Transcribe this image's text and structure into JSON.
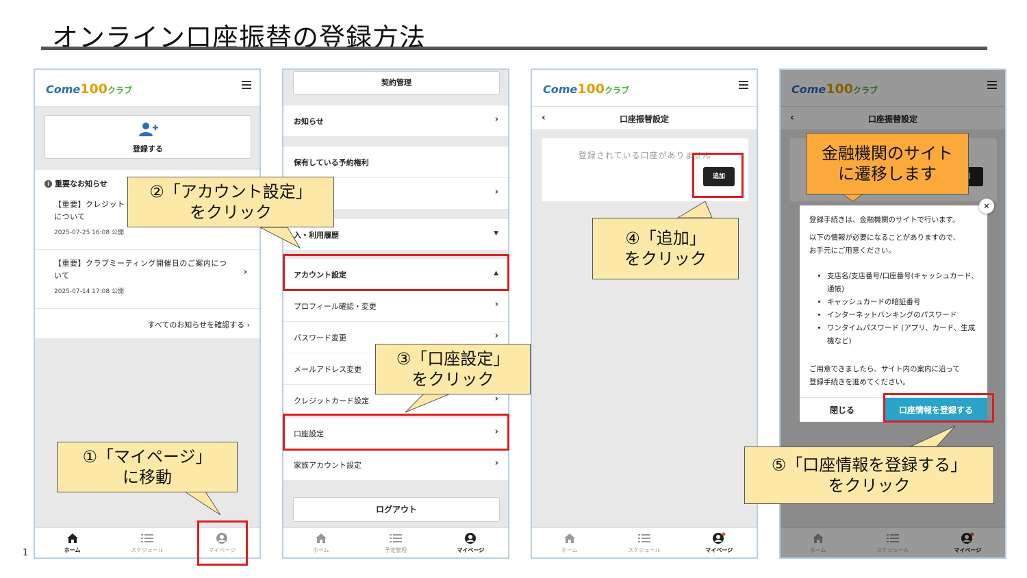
{
  "slide": {
    "title": "オンライン口座振替の登録方法",
    "page_number": "1"
  },
  "logo": {
    "part1": "Come",
    "part2": "100",
    "part3": "クラブ"
  },
  "bottom_nav": {
    "home": "ホーム",
    "schedule": "スケジュール",
    "reservation": "予定管理",
    "mypage": "マイページ"
  },
  "phone1": {
    "register_label": "登録する",
    "notice_heading": "重要なお知らせ",
    "notices": [
      {
        "title_line1": "【重要】クレジット",
        "title_line2": "について",
        "date": "2025-07-25 16:08 公開"
      },
      {
        "title_line1": "【重要】クラブミーティング開催日のご案内につ",
        "title_line2": "いて",
        "date": "2025-07-14 17:08 公開"
      }
    ],
    "all_link": "すべてのお知らせを確認する ›"
  },
  "phone2": {
    "top_button": "契約管理",
    "menu": [
      "お知らせ",
      "保有している予約権利",
      "",
      "入・利用履歴",
      "アカウント設定",
      "プロフィール確認・変更",
      "パスワード変更",
      "メールアドレス変更",
      "クレジットカード設定",
      "口座設定",
      "家族アカウント設定"
    ],
    "logout": "ログアウト"
  },
  "phone3": {
    "header_title": "口座振替設定",
    "empty_message": "登録されている口座がありません",
    "add_button": "追加"
  },
  "phone4": {
    "header_title": "口座振替設定",
    "add_button": "加",
    "modal": {
      "line1": "登録手続きは、金融機関のサイトで行います。",
      "line2a": "以下の情報が必要になることがありますので、",
      "line2b": "お手元にご用意ください。",
      "items": [
        "支店名/支店番号/口座番号(キャッシュカード、通帳)",
        "キャッシュカードの暗証番号",
        "インターネットバンキングのパスワード",
        "ワンタイムパスワード (アプリ、カード、生成機など)"
      ],
      "line3a": "ご用意できましたら、サイト内の案内に沿って",
      "line3b": "登録手続きを進めてください。",
      "close_label": "閉じる",
      "primary_label": "口座情報を登録する",
      "close_x": "×"
    }
  },
  "callouts": {
    "c1": {
      "line1": "①「マイページ」",
      "line2": "に移動"
    },
    "c2": {
      "line1": "②「アカウント設定」",
      "line2": "をクリック"
    },
    "c3": {
      "line1": "③「口座設定」",
      "line2": "をクリック"
    },
    "c4": {
      "line1": "④「追加」",
      "line2": "をクリック"
    },
    "c5": {
      "line1": "⑤「口座情報を登録する」",
      "line2": "をクリック"
    },
    "c6": {
      "line1": "金融機関のサイト",
      "line2": "に遷移します"
    }
  },
  "colors": {
    "highlight": "#d82020",
    "callout": "#fde9a7",
    "callout_orange": "#fba93b",
    "primary_button": "#2ba3c9",
    "phone_border": "#b9cfe4"
  }
}
